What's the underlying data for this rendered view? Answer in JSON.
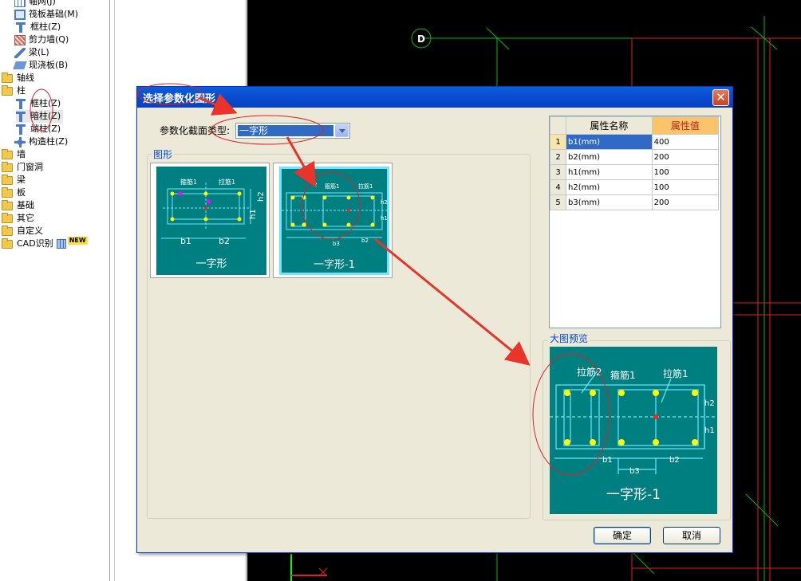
{
  "tree": {
    "items": [
      {
        "label": "轴网(J)",
        "type": "leaf"
      },
      {
        "label": "筏板基础(M)",
        "type": "leaf"
      },
      {
        "label": "框柱(Z)",
        "type": "leaf"
      },
      {
        "label": "剪力墙(Q)",
        "type": "leaf"
      },
      {
        "label": "梁(L)",
        "type": "leaf"
      },
      {
        "label": "现浇板(B)",
        "type": "leaf"
      },
      {
        "label": "轴线",
        "type": "folder"
      },
      {
        "label": "柱",
        "type": "folder"
      },
      {
        "label": "框柱(Z)",
        "type": "leaf"
      },
      {
        "label": "暗柱(Z)",
        "type": "leaf",
        "selected": true
      },
      {
        "label": "端柱(Z)",
        "type": "leaf"
      },
      {
        "label": "构造柱(Z)",
        "type": "leaf"
      },
      {
        "label": "墙",
        "type": "folder"
      },
      {
        "label": "门窗洞",
        "type": "folder"
      },
      {
        "label": "梁",
        "type": "folder"
      },
      {
        "label": "板",
        "type": "folder"
      },
      {
        "label": "基础",
        "type": "folder"
      },
      {
        "label": "其它",
        "type": "folder"
      },
      {
        "label": "自定义",
        "type": "folder"
      },
      {
        "label": "CAD识别",
        "type": "folder"
      }
    ],
    "new_badge": "NEW"
  },
  "cad": {
    "axis_label": "D",
    "line_color": "#00c000",
    "highlight_color": "#e02020"
  },
  "dialog": {
    "title": "选择参数化图形",
    "close_label": "✕",
    "section_type_label": "参数化截面类型:",
    "section_type_value": "一字形",
    "shapes_group_title": "图形",
    "thumbs": [
      {
        "caption": "一字形",
        "labels": [
          "箍筋1",
          "拉筋1",
          "b1",
          "b2",
          "h1",
          "h2"
        ]
      },
      {
        "caption": "一字形-1",
        "labels": [
          "2",
          "箍筋1",
          "拉筋1",
          "b3",
          "b2",
          "h2",
          "h1"
        ],
        "selected": true
      }
    ],
    "props": {
      "col_name": "属性名称",
      "col_value": "属性值",
      "rows": [
        {
          "idx": "1",
          "name": "b1(mm)",
          "value": "400"
        },
        {
          "idx": "2",
          "name": "b2(mm)",
          "value": "200"
        },
        {
          "idx": "3",
          "name": "h1(mm)",
          "value": "100"
        },
        {
          "idx": "4",
          "name": "h2(mm)",
          "value": "100"
        },
        {
          "idx": "5",
          "name": "b3(mm)",
          "value": "200"
        }
      ]
    },
    "preview": {
      "title": "大图预览",
      "caption": "一字形-1",
      "labels": {
        "tie2": "拉筋2",
        "stirrup1": "箍筋1",
        "tie1": "拉筋1",
        "h2": "h2",
        "h1": "h1",
        "b1": "b1",
        "b3": "b3",
        "b2": "b2"
      }
    },
    "ok_label": "确定",
    "cancel_label": "取消"
  },
  "colors": {
    "teal": "#007f80",
    "rebar": "#6fe5ff",
    "dot": "#ffff00",
    "accent_red": "#e02020",
    "title_blue": "#0b4ed3"
  }
}
